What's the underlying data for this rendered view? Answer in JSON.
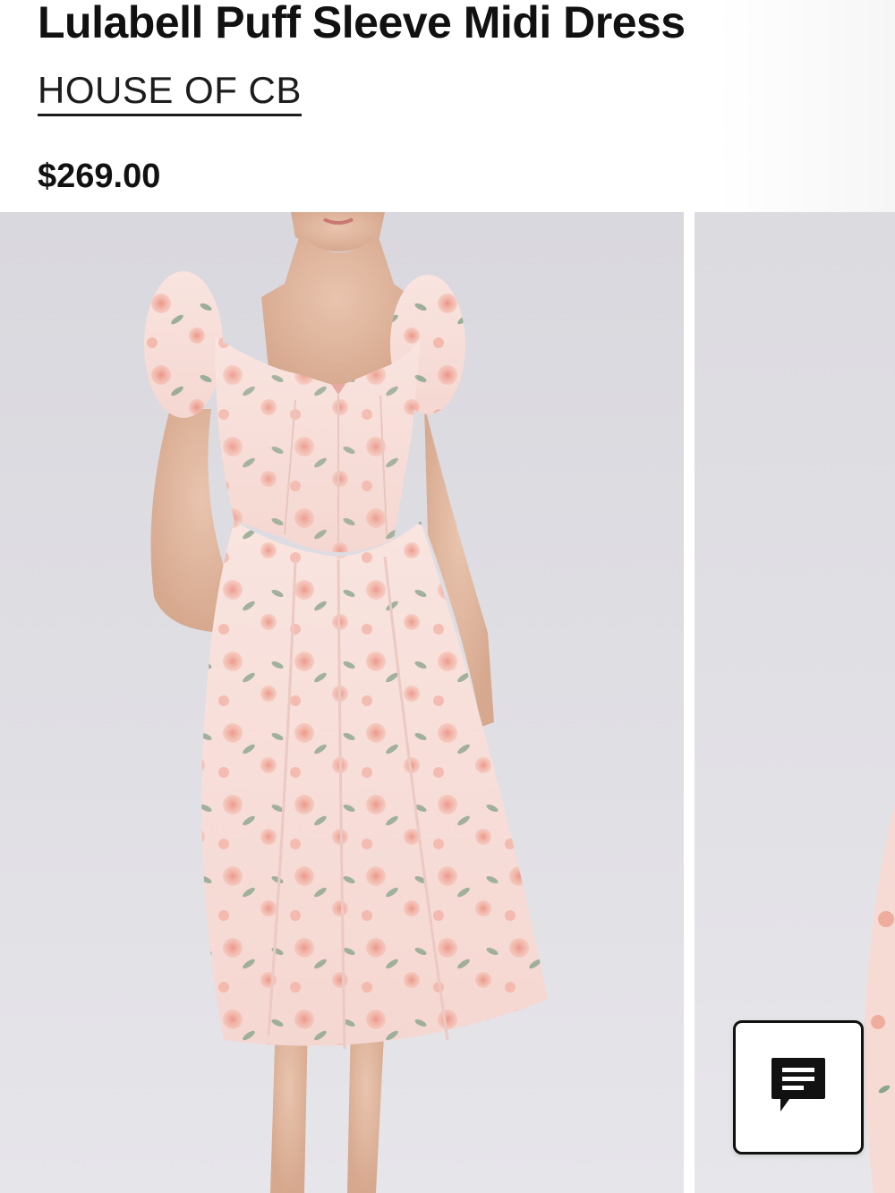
{
  "product": {
    "title": "Lulabell Puff Sleeve Midi Dress",
    "brand": "HOUSE OF CB",
    "price": "$269.00"
  },
  "gallery": {
    "images": [
      {
        "description": "Model wearing pink floral puff sleeve midi dress, front view"
      },
      {
        "description": "Next product image, partially visible"
      }
    ]
  },
  "chat": {
    "icon": "chat-bubble-icon"
  },
  "colors": {
    "background": "#ffffff",
    "text": "#111111",
    "photo_backdrop": "#dedde2",
    "dress_pink": "#f7dcd7",
    "flower_coral": "#ec9a86",
    "leaf_green": "#7f9a82"
  }
}
